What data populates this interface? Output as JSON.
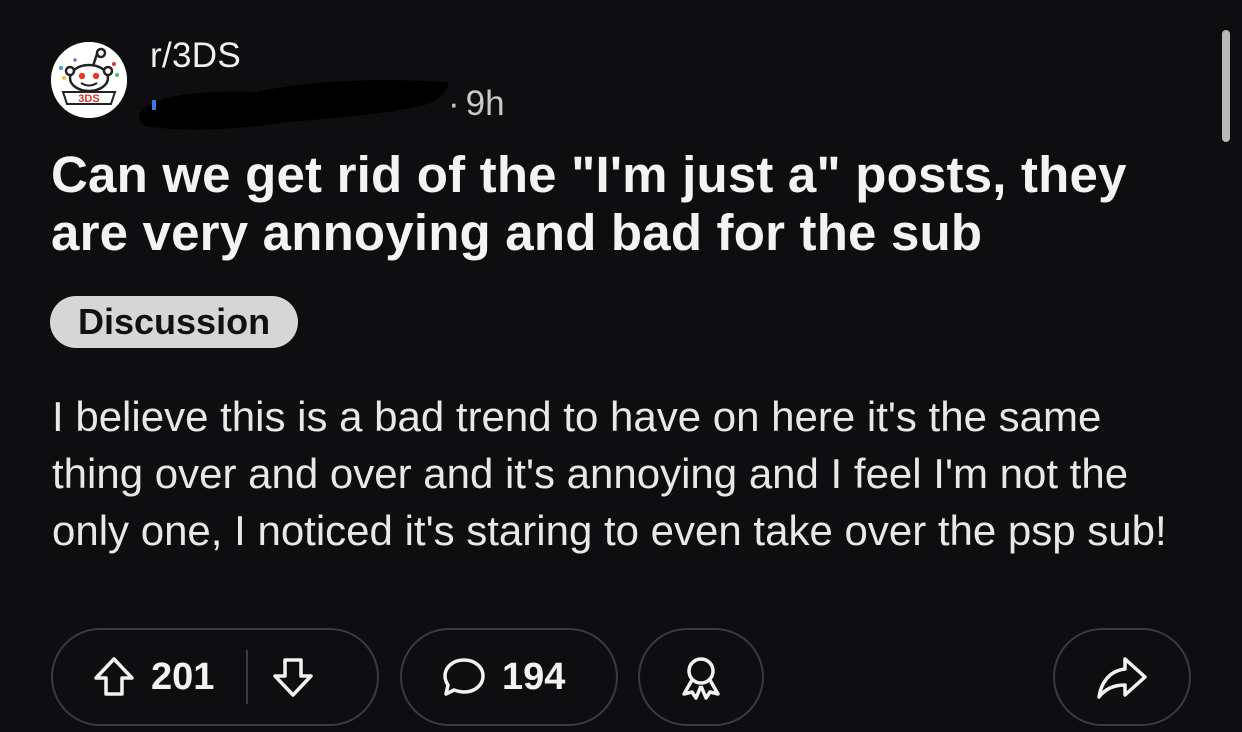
{
  "post": {
    "subreddit": "r/3DS",
    "avatar_icon": "reddit-snoo-3ds-icon",
    "avatar_text": "3DS",
    "age": "9h",
    "title": "Can we get rid of the \"I'm just a\" posts, they are very annoying and bad for the sub",
    "flair": "Discussion",
    "body": "I believe this is a bad trend to have on here it's the same thing over and over and it's annoying and I feel I'm not the only one, I noticed it's staring to even take over the psp sub!"
  },
  "actions": {
    "upvote_icon": "upvote-arrow-icon",
    "score": "201",
    "downvote_icon": "downvote-arrow-icon",
    "comment_icon": "comment-bubble-icon",
    "comments": "194",
    "award_icon": "award-ribbon-icon",
    "share_icon": "share-arrow-icon"
  },
  "colors": {
    "background": "#0e0e10",
    "flair_bg": "#d6d6d6",
    "pill_border": "#3b3b3e"
  }
}
